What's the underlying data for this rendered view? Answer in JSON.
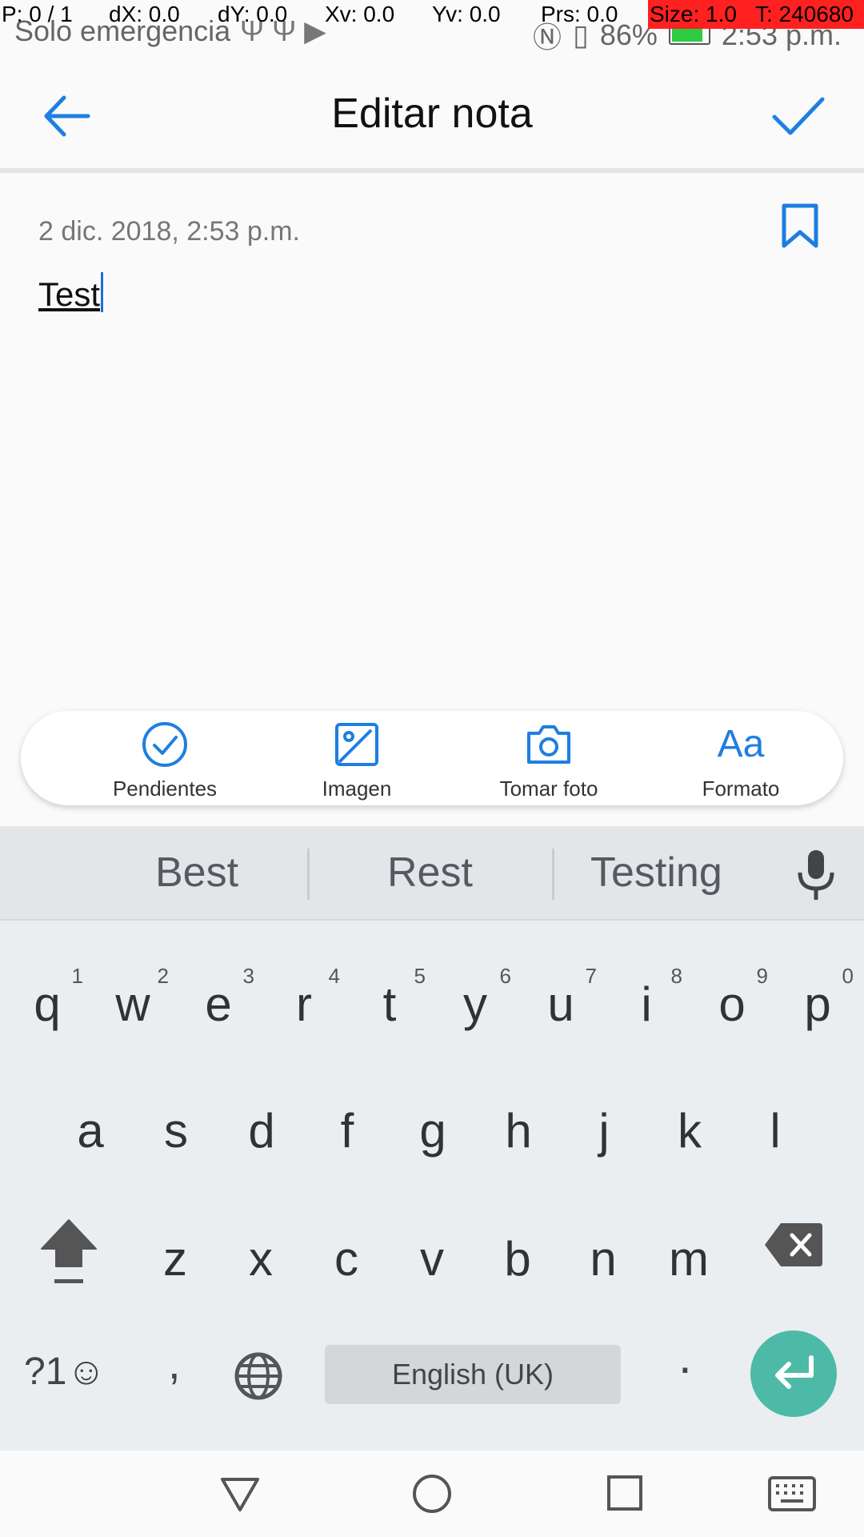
{
  "status_bar": {
    "carrier": "Solo emergencia",
    "battery_percent": "86%",
    "time": "2:53 p.m."
  },
  "debug_overlay": {
    "p": "P: 0 / 1",
    "dx": "dX: 0.0",
    "dy": "dY: 0.0",
    "xv": "Xv: 0.0",
    "yv": "Yv: 0.0",
    "prs": "Prs: 0.0",
    "size": "Size: 1.0",
    "t": "T: 240680"
  },
  "app_bar": {
    "title": "Editar nota",
    "icon_back": "arrow-left-icon",
    "icon_confirm": "check-icon"
  },
  "note": {
    "date": "2 dic. 2018, 2:53 p.m.",
    "text": "Test"
  },
  "toolbar": {
    "items": [
      {
        "label": "Pendientes",
        "icon": "checklist-circle-icon"
      },
      {
        "label": "Imagen",
        "icon": "image-icon"
      },
      {
        "label": "Tomar foto",
        "icon": "camera-icon"
      },
      {
        "label": "Formato",
        "icon": "format-text-icon",
        "glyph": "Aa"
      }
    ]
  },
  "keyboard": {
    "suggestions": [
      "Best",
      "Rest",
      "Testing"
    ],
    "row1": [
      "q",
      "w",
      "e",
      "r",
      "t",
      "y",
      "u",
      "i",
      "o",
      "p"
    ],
    "row1_numbers": [
      "1",
      "2",
      "3",
      "4",
      "5",
      "6",
      "7",
      "8",
      "9",
      "0"
    ],
    "row2": [
      "a",
      "s",
      "d",
      "f",
      "g",
      "h",
      "j",
      "k",
      "l"
    ],
    "row3": [
      "z",
      "x",
      "c",
      "v",
      "b",
      "n",
      "m"
    ],
    "symbols_label": "?1☺",
    "comma": ",",
    "period": ".",
    "space_label": "English (UK)"
  },
  "colors": {
    "accent": "#1e7fe0",
    "enter_key": "#4dbaa8"
  }
}
